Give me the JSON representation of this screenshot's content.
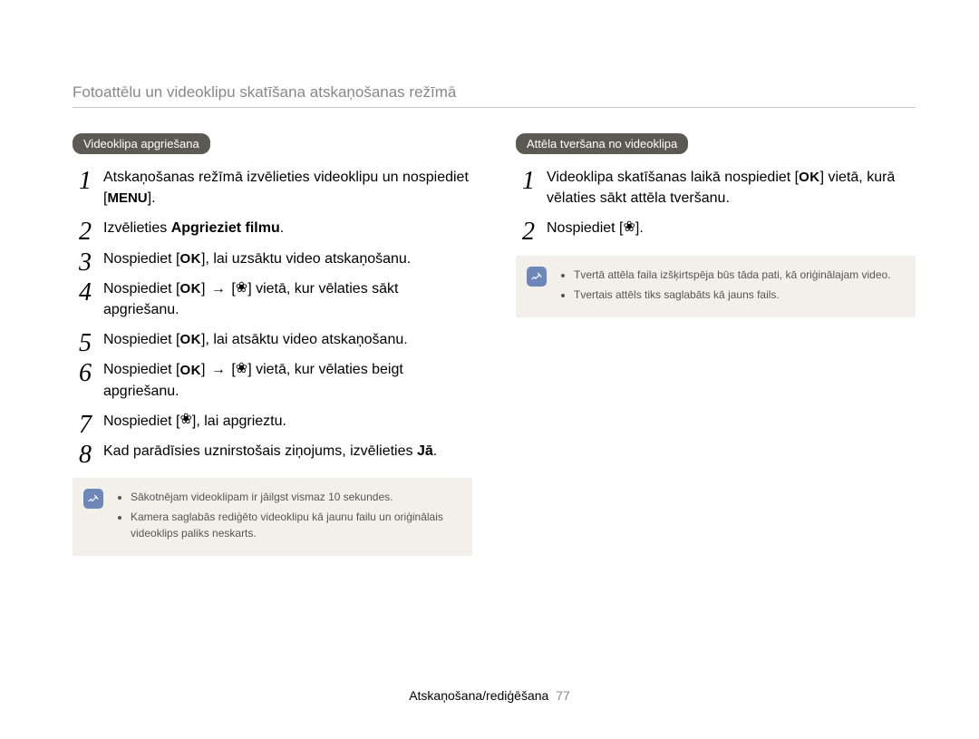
{
  "page_title": "Fotoattēlu un videoklipu skatīšana atskaņošanas režīmā",
  "footer": {
    "section": "Atskaņošana/rediģēšana",
    "page": "77"
  },
  "icons": {
    "ok": "OK",
    "menu": "MENU",
    "flower": "❀",
    "arrow": "→"
  },
  "left": {
    "heading": "Videoklipa apgriešana",
    "steps": [
      {
        "parts": [
          {
            "t": "text",
            "v": "Atskaņošanas režīmā izvēlieties videoklipu un nospiediet ["
          },
          {
            "t": "icon",
            "v": "menu"
          },
          {
            "t": "text",
            "v": "]."
          }
        ]
      },
      {
        "parts": [
          {
            "t": "text",
            "v": "Izvēlieties "
          },
          {
            "t": "bold",
            "v": "Apgrieziet filmu"
          },
          {
            "t": "text",
            "v": "."
          }
        ]
      },
      {
        "parts": [
          {
            "t": "text",
            "v": "Nospiediet ["
          },
          {
            "t": "icon",
            "v": "ok"
          },
          {
            "t": "text",
            "v": "], lai uzsāktu video atskaņošanu."
          }
        ]
      },
      {
        "parts": [
          {
            "t": "text",
            "v": "Nospiediet ["
          },
          {
            "t": "icon",
            "v": "ok"
          },
          {
            "t": "text",
            "v": "] "
          },
          {
            "t": "icon",
            "v": "arrow"
          },
          {
            "t": "text",
            "v": " ["
          },
          {
            "t": "icon",
            "v": "flower"
          },
          {
            "t": "text",
            "v": "] vietā, kur vēlaties sākt apgriešanu."
          }
        ]
      },
      {
        "parts": [
          {
            "t": "text",
            "v": "Nospiediet ["
          },
          {
            "t": "icon",
            "v": "ok"
          },
          {
            "t": "text",
            "v": "], lai atsāktu video atskaņošanu."
          }
        ]
      },
      {
        "parts": [
          {
            "t": "text",
            "v": "Nospiediet ["
          },
          {
            "t": "icon",
            "v": "ok"
          },
          {
            "t": "text",
            "v": "] "
          },
          {
            "t": "icon",
            "v": "arrow"
          },
          {
            "t": "text",
            "v": " ["
          },
          {
            "t": "icon",
            "v": "flower"
          },
          {
            "t": "text",
            "v": "] vietā, kur vēlaties beigt apgriešanu."
          }
        ]
      },
      {
        "parts": [
          {
            "t": "text",
            "v": "Nospiediet ["
          },
          {
            "t": "icon",
            "v": "flower"
          },
          {
            "t": "text",
            "v": "], lai apgrieztu."
          }
        ]
      },
      {
        "parts": [
          {
            "t": "text",
            "v": "Kad parādīsies uznirstošais ziņojums, izvēlieties "
          },
          {
            "t": "bold",
            "v": "Jā"
          },
          {
            "t": "text",
            "v": "."
          }
        ]
      }
    ],
    "notes": [
      "Sākotnējam videoklipam ir jāilgst vismaz 10 sekundes.",
      "Kamera saglabās rediģēto videoklipu kā jaunu failu un oriģinālais videoklips paliks neskarts."
    ]
  },
  "right": {
    "heading": "Attēla tveršana no videoklipa",
    "steps": [
      {
        "parts": [
          {
            "t": "text",
            "v": "Videoklipa skatīšanas laikā nospiediet ["
          },
          {
            "t": "icon",
            "v": "ok"
          },
          {
            "t": "text",
            "v": "] vietā, kurā vēlaties sākt attēla tveršanu."
          }
        ]
      },
      {
        "parts": [
          {
            "t": "text",
            "v": "Nospiediet ["
          },
          {
            "t": "icon",
            "v": "flower"
          },
          {
            "t": "text",
            "v": "]."
          }
        ]
      }
    ],
    "notes": [
      "Tvertā attēla faila izšķirtspēja būs tāda pati, kā oriģinālajam video.",
      "Tvertais attēls tiks saglabāts kā jauns fails."
    ]
  }
}
